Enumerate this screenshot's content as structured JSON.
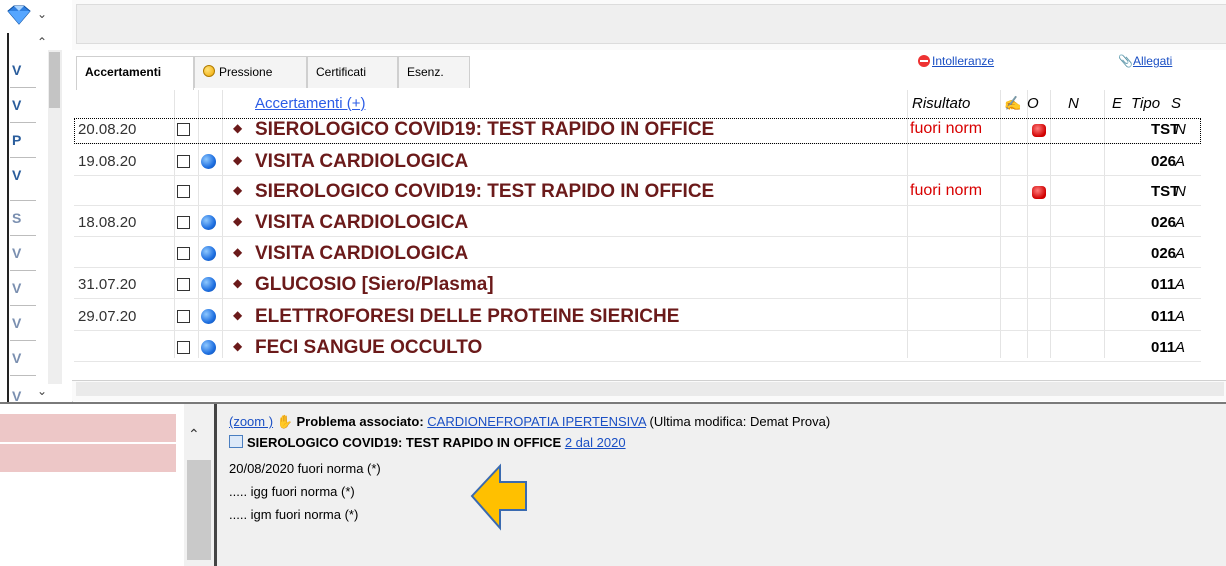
{
  "left_strip": {
    "letters": [
      "V",
      "V",
      "P",
      "V",
      "S",
      "V",
      "V",
      "V",
      "V",
      "V"
    ]
  },
  "tabs": [
    {
      "label": "Accertamenti",
      "active": true
    },
    {
      "label": "Pressione",
      "icon": "yellow-dot-icon"
    },
    {
      "label": "Certificati"
    },
    {
      "label": "Esenz."
    }
  ],
  "links": {
    "intolleranze": "Intolleranze",
    "allegati": "Allegati"
  },
  "table": {
    "headers": {
      "accertamenti": "Accertamenti (+)",
      "risultato": "Risultato",
      "o": "O",
      "n": "N",
      "e": "E",
      "tipo": "Tipo",
      "s": "S"
    },
    "rows": [
      {
        "date": "20.08.20",
        "ball": false,
        "name": "SIEROLOGICO COVID19: TEST RAPIDO IN OFFICE",
        "result": "fuori norm",
        "red": true,
        "tipo": "TST",
        "s": "N"
      },
      {
        "date": "19.08.20",
        "ball": true,
        "name": "VISITA CARDIOLOGICA",
        "result": "",
        "red": false,
        "tipo": "026",
        "s": "A"
      },
      {
        "date": "",
        "ball": false,
        "name": "SIEROLOGICO COVID19: TEST RAPIDO IN OFFICE",
        "result": "fuori norm",
        "red": true,
        "tipo": "TST",
        "s": "N"
      },
      {
        "date": "18.08.20",
        "ball": true,
        "name": "VISITA CARDIOLOGICA",
        "result": "",
        "red": false,
        "tipo": "026",
        "s": "A"
      },
      {
        "date": "",
        "ball": true,
        "name": "VISITA CARDIOLOGICA",
        "result": "",
        "red": false,
        "tipo": "026",
        "s": "A"
      },
      {
        "date": "31.07.20",
        "ball": true,
        "name": "GLUCOSIO [Siero/Plasma]",
        "result": "",
        "red": false,
        "tipo": "011",
        "s": "A"
      },
      {
        "date": "29.07.20",
        "ball": true,
        "name": "ELETTROFORESI DELLE PROTEINE SIERICHE",
        "result": "",
        "red": false,
        "tipo": "011",
        "s": "A"
      },
      {
        "date": "",
        "ball": true,
        "name": "FECI SANGUE OCCULTO",
        "result": "",
        "red": false,
        "tipo": "011",
        "s": "A"
      }
    ]
  },
  "detail": {
    "zoom": "(zoom )",
    "problema_label": "Problema associato:",
    "problema_value": "CARDIONEFROPATIA IPERTENSIVA",
    "ultima_modifica": "(Ultima modifica: Demat Prova)",
    "test_name": "SIEROLOGICO COVID19: TEST RAPIDO IN OFFICE",
    "test_link": "2 dal 2020",
    "line1": "20/08/2020 fuori norma (*)",
    "line2": "..... igg fuori norma (*)",
    "line3": "..... igm fuori norma (*)"
  },
  "colors": {
    "exam_name": "#6b1a1a",
    "result_red": "#d80000",
    "link_blue": "#1a4fc4",
    "pink_row": "#edc7c7",
    "arrow": "#ffc000"
  }
}
